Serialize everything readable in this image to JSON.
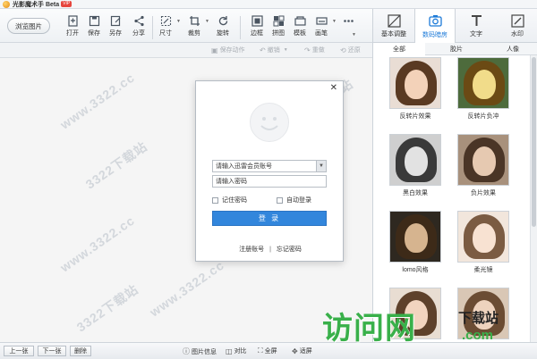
{
  "app": {
    "title": "光影魔术手 Beta",
    "badge": "VIP"
  },
  "toolbar": {
    "browse_label": "浏览图片",
    "tools": [
      {
        "label": "打开",
        "icon": "open-icon"
      },
      {
        "label": "保存",
        "icon": "save-icon"
      },
      {
        "label": "另存",
        "icon": "save-as-icon"
      },
      {
        "label": "分享",
        "icon": "share-icon"
      },
      {
        "label": "尺寸",
        "icon": "resize-icon"
      },
      {
        "label": "裁剪",
        "icon": "crop-icon"
      },
      {
        "label": "旋转",
        "icon": "rotate-icon"
      },
      {
        "label": "边框",
        "icon": "border-icon"
      },
      {
        "label": "拼图",
        "icon": "collage-icon"
      },
      {
        "label": "模板",
        "icon": "template-icon"
      },
      {
        "label": "画笔",
        "icon": "brush-icon"
      }
    ],
    "more_icon": "more-icon"
  },
  "subbar": {
    "save_action": "保存动作",
    "undo": "撤销",
    "redo": "重做",
    "restore": "还原"
  },
  "right_panel": {
    "tabs": [
      {
        "label": "基本调整",
        "icon": "adjust-icon"
      },
      {
        "label": "数码暗房",
        "icon": "camera-icon"
      },
      {
        "label": "文字",
        "icon": "text-icon"
      },
      {
        "label": "水印",
        "icon": "watermark-icon"
      }
    ],
    "subtabs": [
      "全部",
      "胶片",
      "人像"
    ],
    "effects": [
      {
        "label": "反转片效果",
        "tone": "warm"
      },
      {
        "label": "反转片负冲",
        "tone": "yellow"
      },
      {
        "label": "黑白效果",
        "tone": "bw"
      },
      {
        "label": "负片效果",
        "tone": "sepia"
      },
      {
        "label": "lomo风格",
        "tone": "lomo"
      },
      {
        "label": "柔光镜",
        "tone": "soft"
      }
    ]
  },
  "login_dialog": {
    "account_placeholder": "请输入迅雷会员账号",
    "password_placeholder": "请输入密码",
    "remember_label": "记住密码",
    "auto_login_label": "自动登录",
    "login_button": "登 录",
    "register_link": "注册账号",
    "separator": "|",
    "forgot_link": "忘记密码"
  },
  "bottombar": {
    "prev": "上一张",
    "next": "下一张",
    "delete": "删除",
    "info": "图片信息",
    "compare": "对比",
    "fullscreen": "全屏",
    "fit": "适屏"
  },
  "watermarks": [
    "3322下载站",
    "www.3322.cc"
  ],
  "brand": {
    "main": "访问网",
    "sub": "下载站",
    "domain": ".com"
  },
  "colors": {
    "accent": "#3286dc",
    "brand_green": "#39b04a",
    "active_tab": "#1c7ad8"
  }
}
